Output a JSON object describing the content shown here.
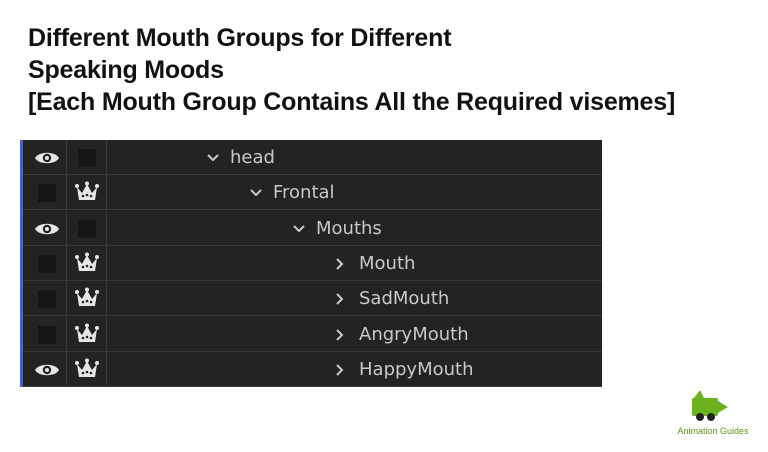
{
  "title": {
    "line1": "Different Mouth Groups for Different",
    "line2": "Speaking Moods",
    "line3": "[Each Mouth Group Contains All the Required visemes]"
  },
  "layers": [
    {
      "label": "head",
      "visible": true,
      "locked": false,
      "expanded": true,
      "indent": 0
    },
    {
      "label": "Frontal",
      "visible": false,
      "locked": true,
      "expanded": true,
      "indent": 1
    },
    {
      "label": "Mouths",
      "visible": true,
      "locked": false,
      "expanded": true,
      "indent": 2
    },
    {
      "label": "Mouth",
      "visible": false,
      "locked": true,
      "expanded": false,
      "indent": 3
    },
    {
      "label": "SadMouth",
      "visible": false,
      "locked": true,
      "expanded": false,
      "indent": 3
    },
    {
      "label": "AngryMouth",
      "visible": false,
      "locked": true,
      "expanded": false,
      "indent": 3
    },
    {
      "label": "HappyMouth",
      "visible": true,
      "locked": true,
      "expanded": false,
      "indent": 3
    }
  ],
  "logo": {
    "text": "Animation Guides"
  },
  "colors": {
    "panel": "#232323",
    "text": "#c9c9c9",
    "accent": "#4a5fd0",
    "logo": "#6bb21f"
  },
  "icons": {
    "visible": "eye-icon",
    "locked": "crown-icon",
    "expanded": "chevron-down-icon",
    "collapsed": "chevron-right-icon"
  }
}
